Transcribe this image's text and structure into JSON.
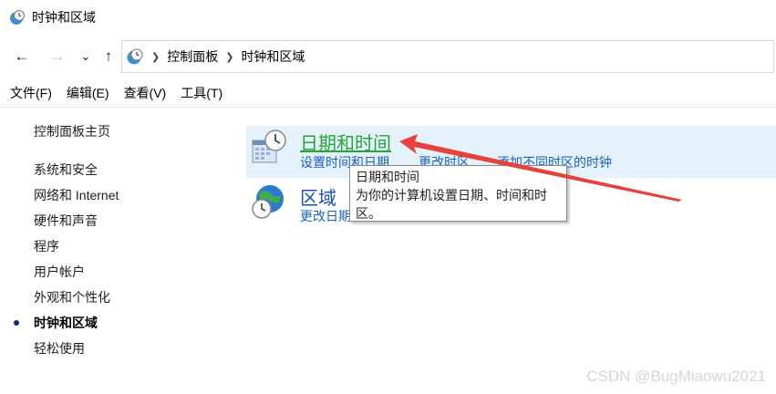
{
  "window": {
    "title": "时钟和区域",
    "icon": "clock-globe-icon"
  },
  "navigation": {
    "back_icon": "←",
    "forward_icon": "→",
    "recent_icon": "⌄",
    "up_icon": "↑",
    "breadcrumb": [
      "控制面板",
      "时钟和区域"
    ],
    "separator": "❯"
  },
  "menu": {
    "items": [
      "文件(F)",
      "编辑(E)",
      "查看(V)",
      "工具(T)"
    ]
  },
  "sidebar": {
    "home": "控制面板主页",
    "items": [
      {
        "label": "系统和安全",
        "active": false
      },
      {
        "label": "网络和 Internet",
        "active": false
      },
      {
        "label": "硬件和声音",
        "active": false
      },
      {
        "label": "程序",
        "active": false
      },
      {
        "label": "用户帐户",
        "active": false
      },
      {
        "label": "外观和个性化",
        "active": false
      },
      {
        "label": "时钟和区域",
        "active": true
      },
      {
        "label": "轻松使用",
        "active": false
      }
    ]
  },
  "main": {
    "categories": [
      {
        "title": "日期和时间",
        "icon": "calendar-clock-icon",
        "state": "hover",
        "links": [
          "设置时间和日期",
          "更改时区",
          "添加不同时区的时钟"
        ]
      },
      {
        "title": "区域",
        "icon": "globe-clock-icon",
        "state": "normal",
        "links": [
          "更改日期"
        ]
      }
    ]
  },
  "tooltip": {
    "title": "日期和时间",
    "body": "为你的计算机设置日期、时间和时区。"
  },
  "watermark": "CSDN @BugMiaowu2021",
  "colors": {
    "hover_title": "#24a639",
    "link": "#1a61c6",
    "highlight": "#e5f1fb",
    "annotation_arrow": "#e8403a"
  }
}
